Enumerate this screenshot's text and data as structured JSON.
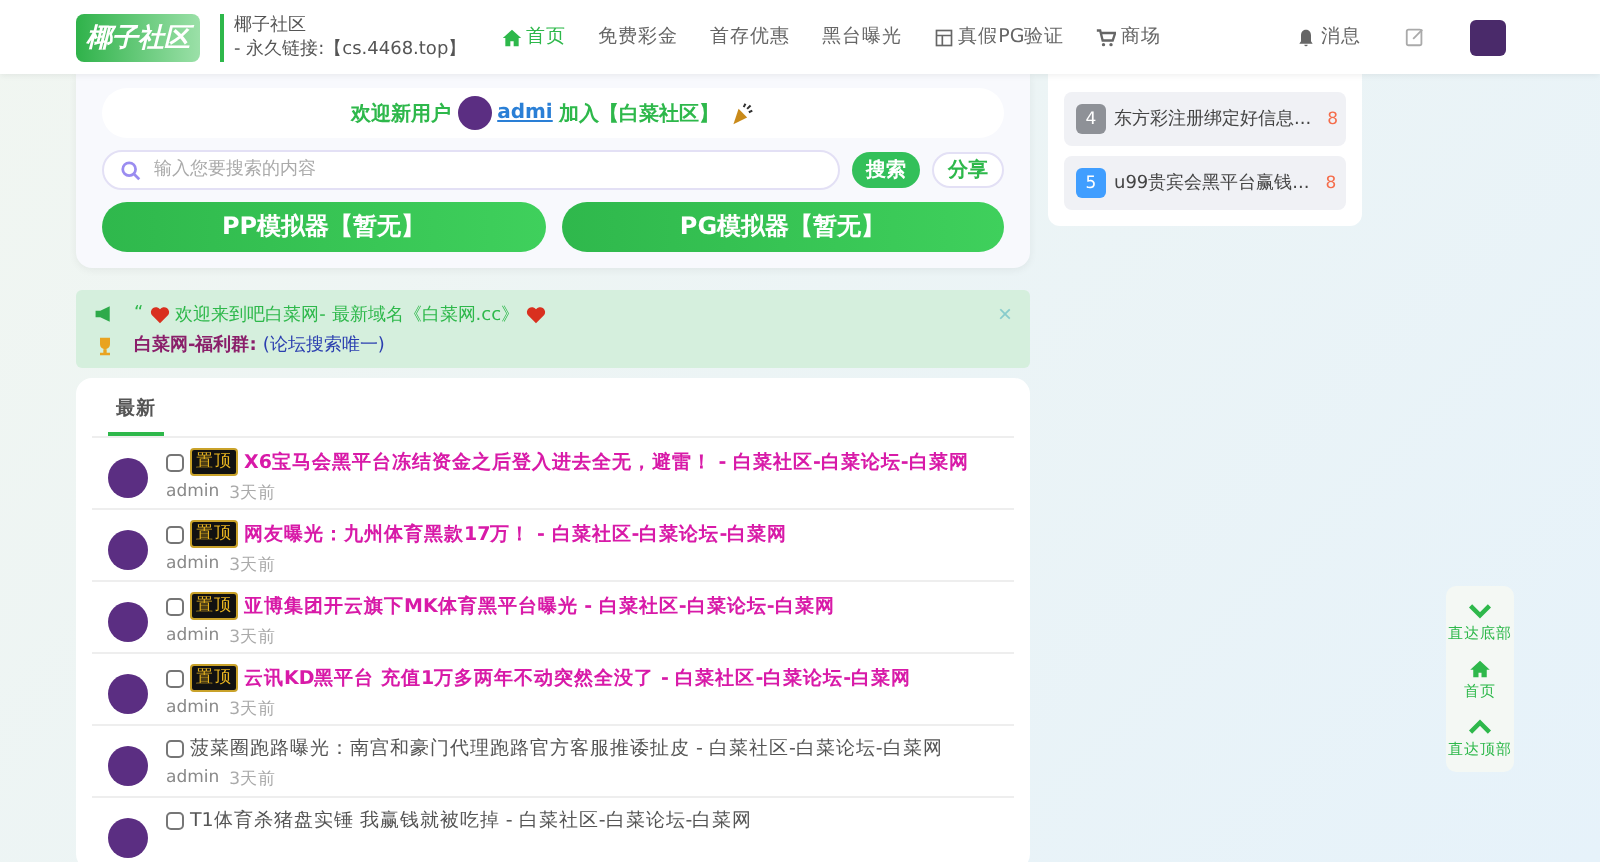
{
  "header": {
    "logo": "椰子社区",
    "site_name": "椰子社区",
    "site_link": "- 永久链接:【cs.4468.top】",
    "nav": [
      {
        "label": "首页",
        "selected": true,
        "kind": "home"
      },
      {
        "label": "免费彩金",
        "selected": false
      },
      {
        "label": "首存优惠",
        "selected": false
      },
      {
        "label": "黑台曝光",
        "selected": false
      },
      {
        "label": "真假PG验证",
        "selected": false,
        "kind": "doc"
      },
      {
        "label": "商场",
        "selected": false,
        "kind": "cart"
      }
    ],
    "messages": "消息"
  },
  "welcome": {
    "prefix": "欢迎新用户",
    "user": "admi",
    "suffix": "加入【白菜社区】"
  },
  "search": {
    "placeholder": "输入您要搜索的内容",
    "buttons": [
      "搜索",
      "分享"
    ]
  },
  "simulators": [
    "PP模拟器【暂无】",
    "PG模拟器【暂无】"
  ],
  "notice": {
    "quote": "“",
    "text": "欢迎来到吧白菜网- 最新域名《白菜网.cc》",
    "group": "白菜网-福利群:",
    "group_note": "(论坛搜索唯一)",
    "close": "×"
  },
  "feed": {
    "tabs": [
      {
        "label": "最新",
        "selected": true
      }
    ],
    "posts": [
      {
        "pinned": true,
        "badge": "置顶",
        "checked": false,
        "title": "X6宝马会黑平台冻结资金之后登入进去全无，避雷！ - 白菜社区-白菜论坛-白菜网",
        "author": "admin",
        "time": "3天前"
      },
      {
        "pinned": true,
        "badge": "置顶",
        "checked": false,
        "title": "网友曝光：九州体育黑款17万！ - 白菜社区-白菜论坛-白菜网",
        "author": "admin",
        "time": "3天前"
      },
      {
        "pinned": true,
        "badge": "置顶",
        "checked": false,
        "title": "亚博集团开云旗下MK体育黑平台曝光 - 白菜社区-白菜论坛-白菜网",
        "author": "admin",
        "time": "3天前"
      },
      {
        "pinned": true,
        "badge": "置顶",
        "checked": false,
        "title": "云讯KD黑平台 充值1万多两年不动突然全没了 - 白菜社区-白菜论坛-白菜网",
        "author": "admin",
        "time": "3天前"
      },
      {
        "pinned": false,
        "checked": false,
        "title": "菠菜圈跑路曝光：南宫和豪门代理跑路官方客服推诿扯皮 - 白菜社区-白菜论坛-白菜网",
        "author": "admin",
        "time": "3天前"
      },
      {
        "pinned": false,
        "checked": false,
        "title": "T1体育杀猪盘实锤 我赢钱就被吃掉 - 白菜社区-白菜论坛-白菜网"
      }
    ]
  },
  "hot": [
    {
      "rank": "4",
      "color": "#8e9197",
      "title": "东方彩注册绑定好信息...",
      "heat": "8"
    },
    {
      "rank": "5",
      "color": "#409eff",
      "title": "u99贵宾会黑平台赢钱...",
      "heat": "8"
    }
  ],
  "float_bar": [
    {
      "label": "直达底部",
      "kind": "down"
    },
    {
      "label": "首页",
      "kind": "home"
    },
    {
      "label": "直达顶部",
      "kind": "up"
    }
  ]
}
